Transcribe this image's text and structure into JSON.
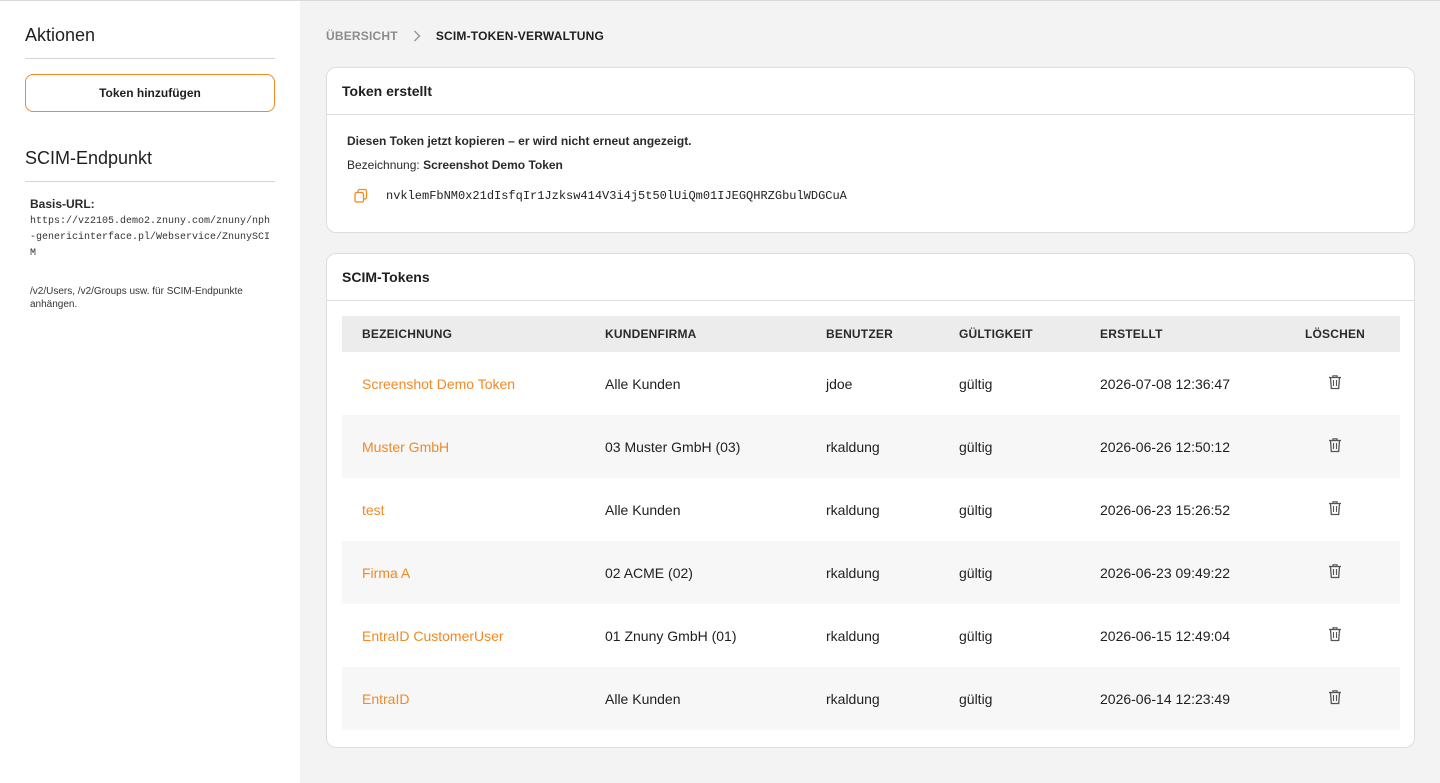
{
  "sidebar": {
    "actions_heading": "Aktionen",
    "add_token_label": "Token hinzufügen",
    "endpoint_heading": "SCIM-Endpunkt",
    "base_url_label": "Basis-URL:",
    "base_url": "https://vz2105.demo2.znuny.com/znuny/nph-genericinterface.pl/Webservice/ZnunySCIM",
    "hint": "/v2/Users, /v2/Groups usw. für SCIM-Endpunkte anhängen."
  },
  "breadcrumb": {
    "overview": "ÜBERSICHT",
    "current": "SCIM-TOKEN-VERWALTUNG",
    "separator_icon": "chevron-right-icon"
  },
  "created": {
    "title": "Token erstellt",
    "copy_note": "Diesen Token jetzt kopieren – er wird nicht erneut angezeigt.",
    "name_label": "Bezeichnung:",
    "name_value": "Screenshot Demo Token",
    "copy_icon": "copy-icon",
    "token": "nvklemFbNM0x21dIsfqIr1Jzksw414V3i4j5t50lUiQm01IJEGQHRZGbulWDGCuA"
  },
  "tokens": {
    "title": "SCIM-Tokens",
    "columns": [
      "BEZEICHNUNG",
      "KUNDENFIRMA",
      "BENUTZER",
      "GÜLTIGKEIT",
      "ERSTELLT",
      "LÖSCHEN"
    ],
    "rows": [
      {
        "name": "Screenshot Demo Token",
        "company": "Alle Kunden",
        "user": "jdoe",
        "validity": "gültig",
        "created": "2026-07-08 12:36:47"
      },
      {
        "name": "Muster GmbH",
        "company": "03 Muster GmbH (03)",
        "user": "rkaldung",
        "validity": "gültig",
        "created": "2026-06-26 12:50:12"
      },
      {
        "name": "test",
        "company": "Alle Kunden",
        "user": "rkaldung",
        "validity": "gültig",
        "created": "2026-06-23 15:26:52"
      },
      {
        "name": "Firma A",
        "company": "02 ACME (02)",
        "user": "rkaldung",
        "validity": "gültig",
        "created": "2026-06-23 09:49:22"
      },
      {
        "name": "EntraID CustomerUser",
        "company": "01 Znuny GmbH (01)",
        "user": "rkaldung",
        "validity": "gültig",
        "created": "2026-06-15 12:49:04"
      },
      {
        "name": "EntraID",
        "company": "Alle Kunden",
        "user": "rkaldung",
        "validity": "gültig",
        "created": "2026-06-14 12:23:49"
      }
    ],
    "delete_icon": "trash-icon"
  },
  "colors": {
    "accent": "#f08a24",
    "background": "#f3f3f4",
    "card": "#ffffff",
    "table_header": "#ececec"
  }
}
